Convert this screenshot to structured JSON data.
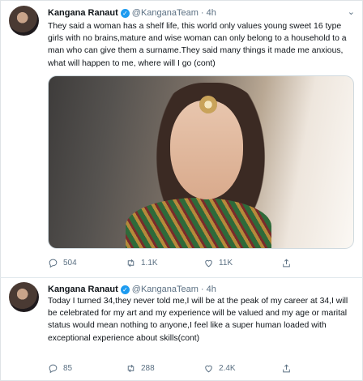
{
  "tweets": [
    {
      "author_name": "Kangana Ranaut",
      "handle": "@KanganaTeam",
      "separator": "·",
      "time": "4h",
      "text": "They said a woman has a shelf life, this world only values young sweet 16 type girls with no brains,mature and wise woman can only belong to a household to a man who can give them a surname.They said many things it made me anxious, what will happen to me, where will I go (cont)",
      "replies": "504",
      "retweets": "1.1K",
      "likes": "11K"
    },
    {
      "author_name": "Kangana Ranaut",
      "handle": "@KanganaTeam",
      "separator": "·",
      "time": "4h",
      "text": "Today I turned 34,they never told me,I will be at the peak of my career at 34,I will be celebrated for my art and my experience will be valued and my age or marital status would mean nothing to anyone,I feel like a super human loaded with exceptional experience about skills(cont)",
      "replies": "85",
      "retweets": "288",
      "likes": "2.4K"
    }
  ],
  "icons": {
    "verified": "verified-badge-icon",
    "more": "chevron-down-icon",
    "reply": "reply-icon",
    "retweet": "retweet-icon",
    "like": "heart-icon",
    "share": "share-icon"
  },
  "colors": {
    "accent": "#1d9bf0",
    "muted": "#5b7083",
    "text": "#0f1419",
    "border": "#e1e8ed"
  }
}
